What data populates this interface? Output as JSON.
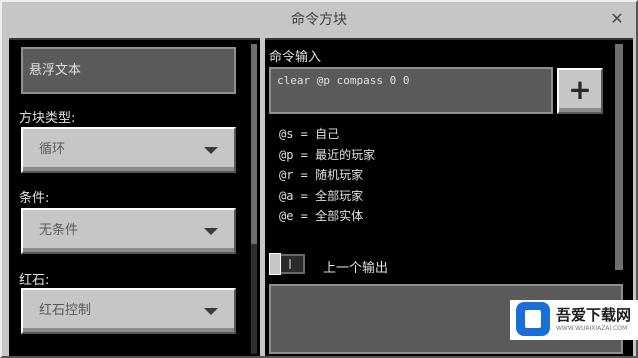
{
  "window": {
    "title": "命令方块"
  },
  "left": {
    "hover_text": "悬浮文本",
    "block_type_label": "方块类型:",
    "block_type_value": "循环",
    "condition_label": "条件:",
    "condition_value": "无条件",
    "redstone_label": "红石:",
    "redstone_value": "红石控制"
  },
  "right": {
    "command_label": "命令输入",
    "command_value": "clear @p compass 0 0",
    "add_button": "+",
    "selectors": [
      "@s = 自己",
      "@p = 最近的玩家",
      "@r = 随机玩家",
      "@a = 全部玩家",
      "@e = 全部实体"
    ],
    "previous_output_label": "上一个输出",
    "previous_output_enabled": false
  },
  "watermark": {
    "brand": "吾爱下载网",
    "url": "WWW.WUAIXIAZAI.COM"
  },
  "icons": {
    "close": "close-icon",
    "dropdown": "chevron-down-icon",
    "add": "plus-icon"
  }
}
